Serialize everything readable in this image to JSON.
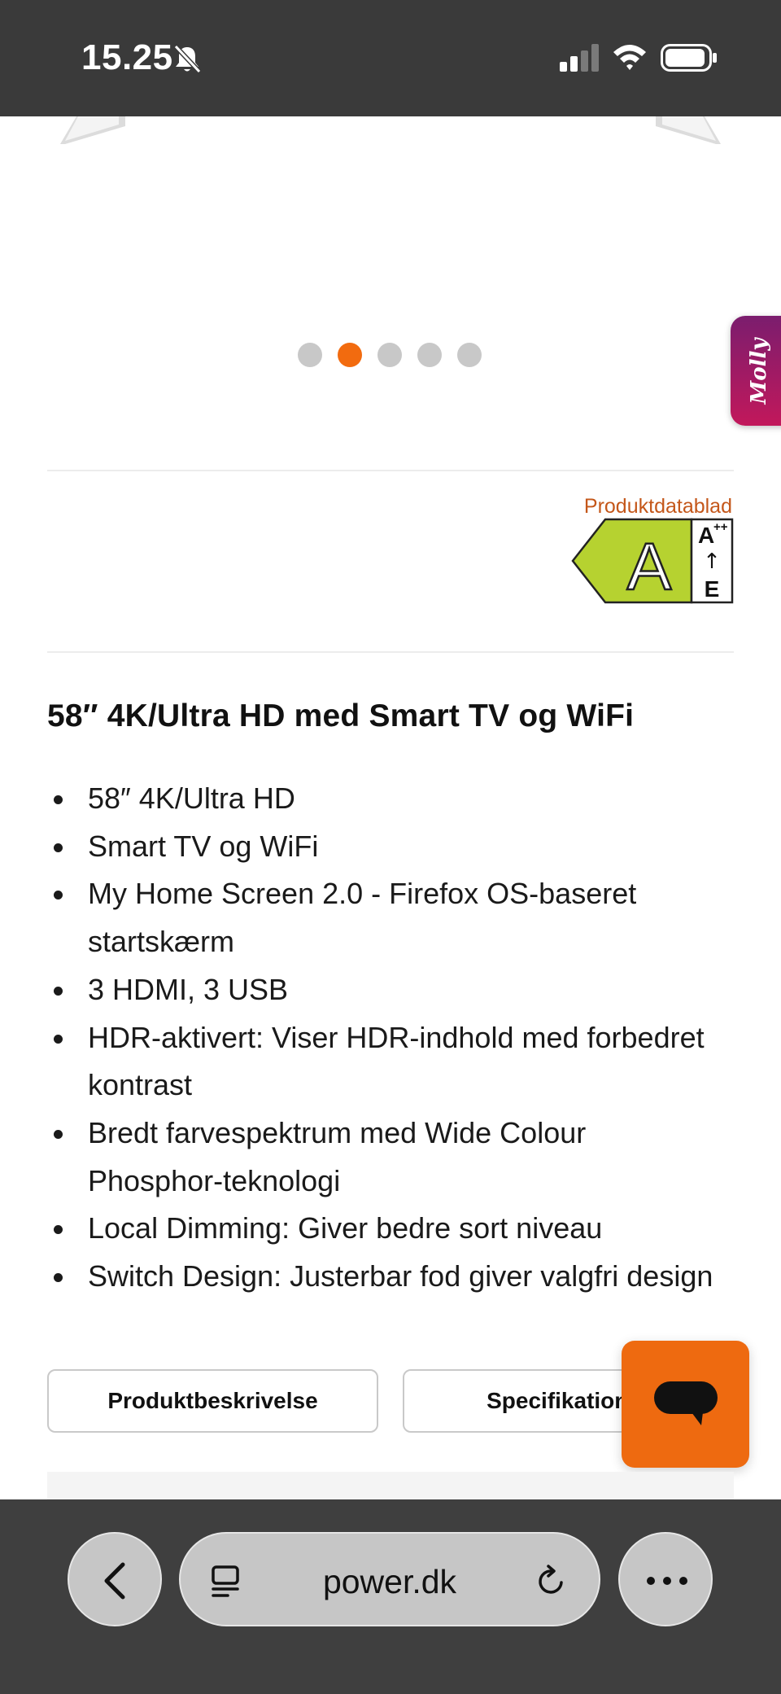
{
  "status_bar": {
    "time": "15.25"
  },
  "carousel": {
    "dot_count": 5,
    "active_index": 1
  },
  "molly": {
    "label": "Molly"
  },
  "energy": {
    "datasheet_link": "Produktdatablad",
    "class": "A",
    "scale_top": "A",
    "scale_top_sup": "++",
    "scale_arrow": "↑",
    "scale_bottom": "E",
    "color": "#b6d230"
  },
  "product": {
    "heading": "58″ 4K/Ultra HD med Smart TV og WiFi",
    "features": [
      "58″ 4K/Ultra HD",
      "Smart TV og WiFi",
      "My Home Screen 2.0 - Firefox OS-baseret startskærm",
      "3 HDMI, 3 USB",
      "HDR-aktivert: Viser HDR-indhold med forbedret kontrast",
      "Bredt farvespektrum med Wide Colour Phosphor-teknologi",
      "Local Dimming: Giver bedre sort niveau",
      "Switch Design: Justerbar fod giver valgfri design"
    ]
  },
  "tabs": {
    "description_label": "Produktbeskrivelse",
    "specifications_label": "Specifikationer"
  },
  "browser": {
    "url": "power.dk"
  },
  "colors": {
    "accent": "#f26b0f",
    "link": "#c4571a",
    "molly_gradient_start": "#7b1d6e",
    "molly_gradient_end": "#c2185b"
  }
}
